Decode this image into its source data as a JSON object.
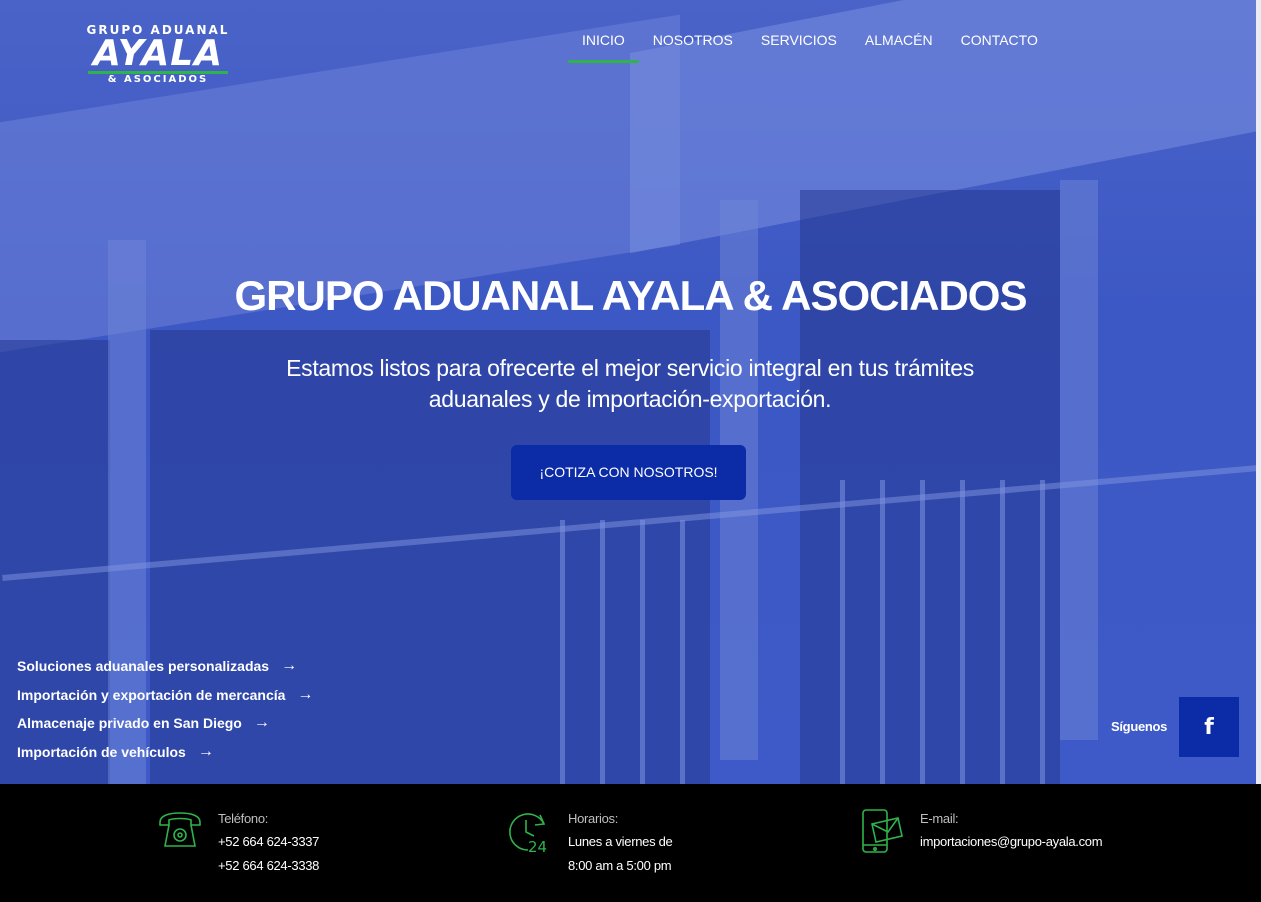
{
  "brand": {
    "line1": "GRUPO ADUANAL",
    "line2": "AYALA",
    "line3": "& ASOCIADOS"
  },
  "nav": {
    "items": [
      {
        "label": "INICIO",
        "active": true
      },
      {
        "label": "NOSOTROS",
        "active": false
      },
      {
        "label": "SERVICIOS",
        "active": false
      },
      {
        "label": "ALMACÉN",
        "active": false
      },
      {
        "label": "CONTACTO",
        "active": false
      }
    ]
  },
  "hero": {
    "title": "GRUPO ADUANAL AYALA & ASOCIADOS",
    "subtitle": "Estamos listos para ofrecerte el mejor servicio integral en tus trámites aduanales y de importación-exportación.",
    "cta_label": "¡COTIZA CON NOSOTROS!"
  },
  "quick_links": [
    "Soluciones aduanales personalizadas",
    "Importación y exportación de mercancía",
    "Almacenaje privado en San Diego",
    "Importación de vehículos"
  ],
  "social": {
    "label": "Síguenos",
    "facebook_glyph": "f"
  },
  "footer": {
    "phone": {
      "label": "Teléfono:",
      "lines": [
        "+52 664 624-3337",
        "+52 664 624-3338"
      ]
    },
    "hours": {
      "label": "Horarios:",
      "lines": [
        "Lunes a viernes de",
        "8:00 am a 5:00 pm"
      ]
    },
    "email": {
      "label": "E-mail:",
      "lines": [
        "importaciones@grupo-ayala.com"
      ]
    }
  },
  "colors": {
    "accent_green": "#2fb34a",
    "button_blue": "#0b2ca6",
    "hero_overlay": "#3c58c4"
  },
  "icons": [
    "arrow-right-icon",
    "facebook-icon",
    "telephone-icon",
    "clock-24-icon",
    "mobile-mail-icon"
  ]
}
